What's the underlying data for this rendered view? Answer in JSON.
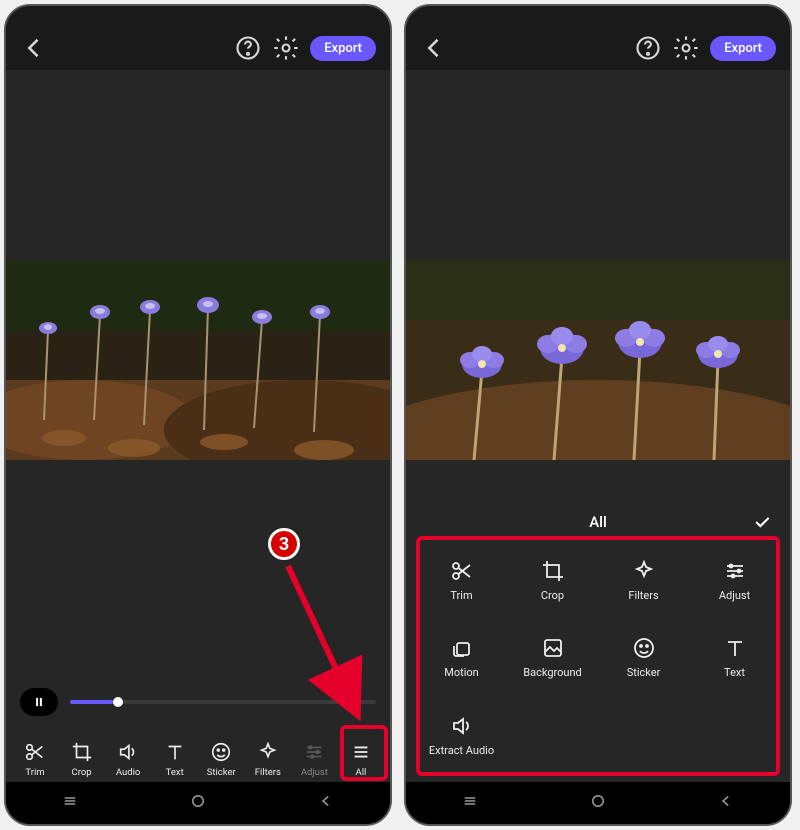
{
  "header": {
    "export": "Export"
  },
  "screen1_tools": {
    "trim": "Trim",
    "crop": "Crop",
    "audio": "Audio",
    "text": "Text",
    "sticker": "Sticker",
    "filters": "Filters",
    "adjust": "Adjust",
    "all": "All"
  },
  "panel": {
    "title": "All"
  },
  "screen2_tools": {
    "trim": "Trim",
    "crop": "Crop",
    "filters": "Filters",
    "adjust": "Adjust",
    "motion": "Motion",
    "background": "Background",
    "sticker": "Sticker",
    "text": "Text",
    "extract_audio": "Extract Audio"
  },
  "annotation": {
    "step": "3"
  }
}
